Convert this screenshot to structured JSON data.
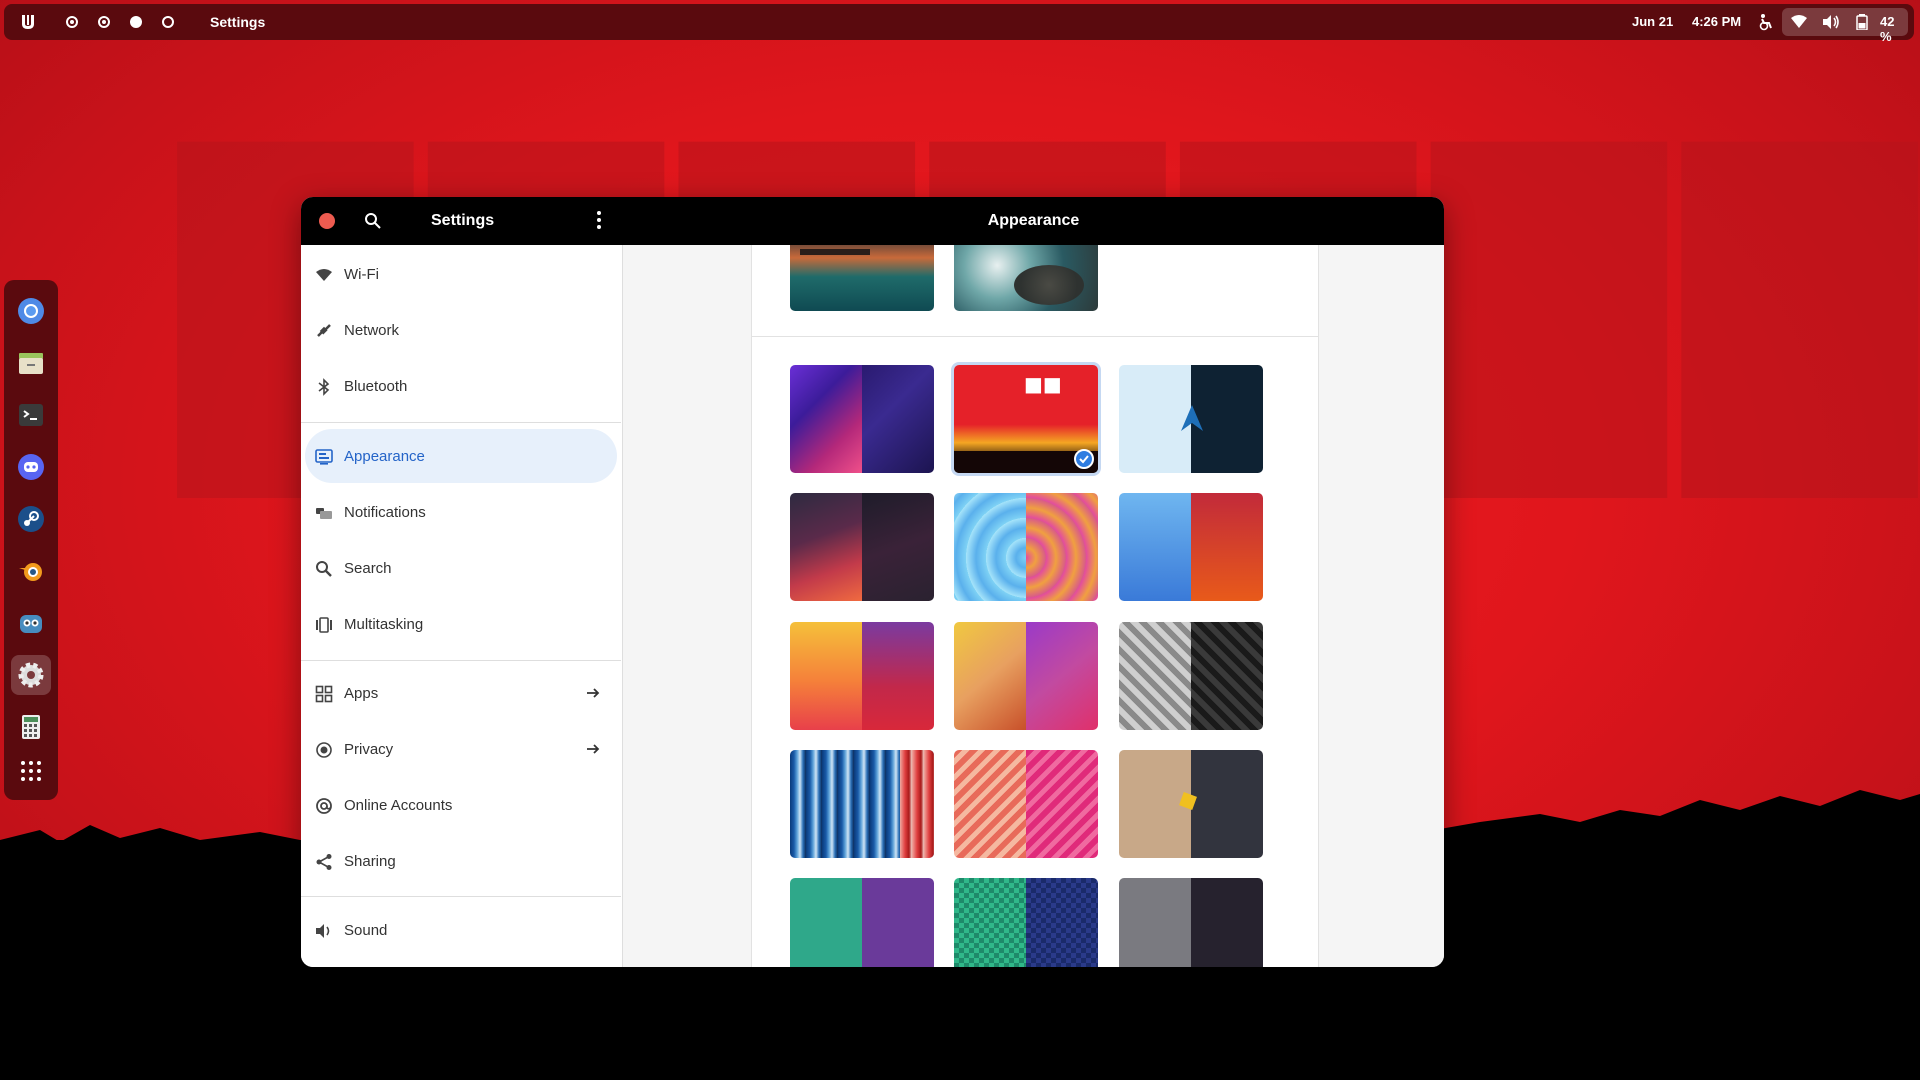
{
  "topbar": {
    "app_name": "Settings",
    "date": "Jun 21",
    "time": "4:26 PM",
    "battery": "42 %"
  },
  "window": {
    "sidebar_title": "Settings",
    "page_title": "Appearance"
  },
  "sidebar": {
    "items": [
      {
        "label": "Wi-Fi",
        "icon": "wifi-icon"
      },
      {
        "label": "Network",
        "icon": "network-icon"
      },
      {
        "label": "Bluetooth",
        "icon": "bluetooth-icon"
      },
      {
        "label": "Appearance",
        "icon": "appearance-icon"
      },
      {
        "label": "Notifications",
        "icon": "notifications-icon"
      },
      {
        "label": "Search",
        "icon": "search-icon"
      },
      {
        "label": "Multitasking",
        "icon": "multitasking-icon"
      },
      {
        "label": "Apps",
        "icon": "apps-icon"
      },
      {
        "label": "Privacy",
        "icon": "privacy-icon"
      },
      {
        "label": "Online Accounts",
        "icon": "online-accounts-icon"
      },
      {
        "label": "Sharing",
        "icon": "sharing-icon"
      },
      {
        "label": "Sound",
        "icon": "sound-icon"
      }
    ],
    "active": "Appearance"
  },
  "dock": {
    "apps": [
      "chromium-icon",
      "files-icon",
      "terminal-icon",
      "discord-icon",
      "steam-icon",
      "blender-icon",
      "godot-icon",
      "settings-icon",
      "calculator-icon",
      "app-grid-icon"
    ],
    "active": "settings-icon"
  },
  "colors": {
    "accent": "#2f7de1",
    "topbar": "#5a0a0e",
    "wallpaper": "#e0161c"
  }
}
